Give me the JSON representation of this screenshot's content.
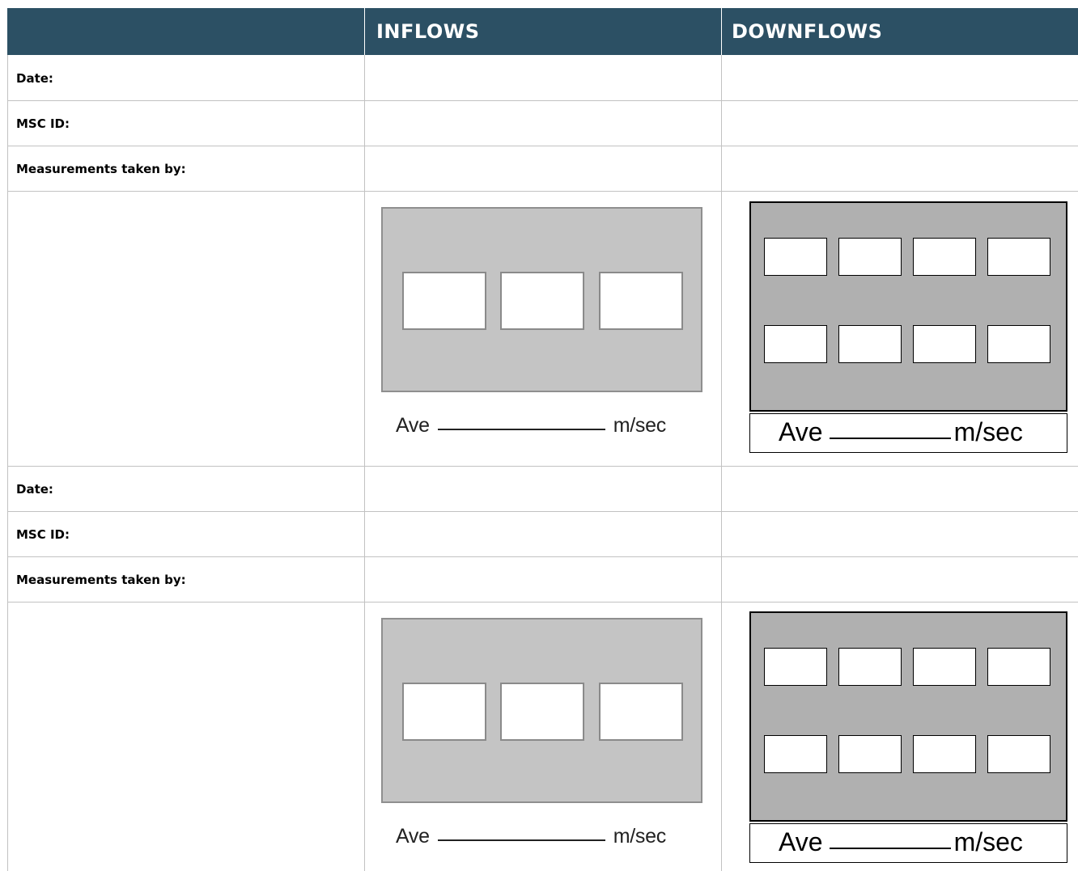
{
  "header": {
    "col1": "",
    "col2": "INFLOWS",
    "col3": "DOWNFLOWS"
  },
  "records": [
    {
      "date_label": "Date:",
      "msc_label": "MSC ID:",
      "measured_by_label": "Measurements taken by:",
      "inflows": {
        "ave_label": "Ave",
        "unit": "m/sec"
      },
      "downflows": {
        "ave_label": "Ave",
        "unit": "m/sec"
      }
    },
    {
      "date_label": "Date:",
      "msc_label": "MSC ID:",
      "measured_by_label": "Measurements taken by:",
      "inflows": {
        "ave_label": "Ave",
        "unit": "m/sec"
      },
      "downflows": {
        "ave_label": "Ave",
        "unit": "m/sec"
      }
    }
  ]
}
